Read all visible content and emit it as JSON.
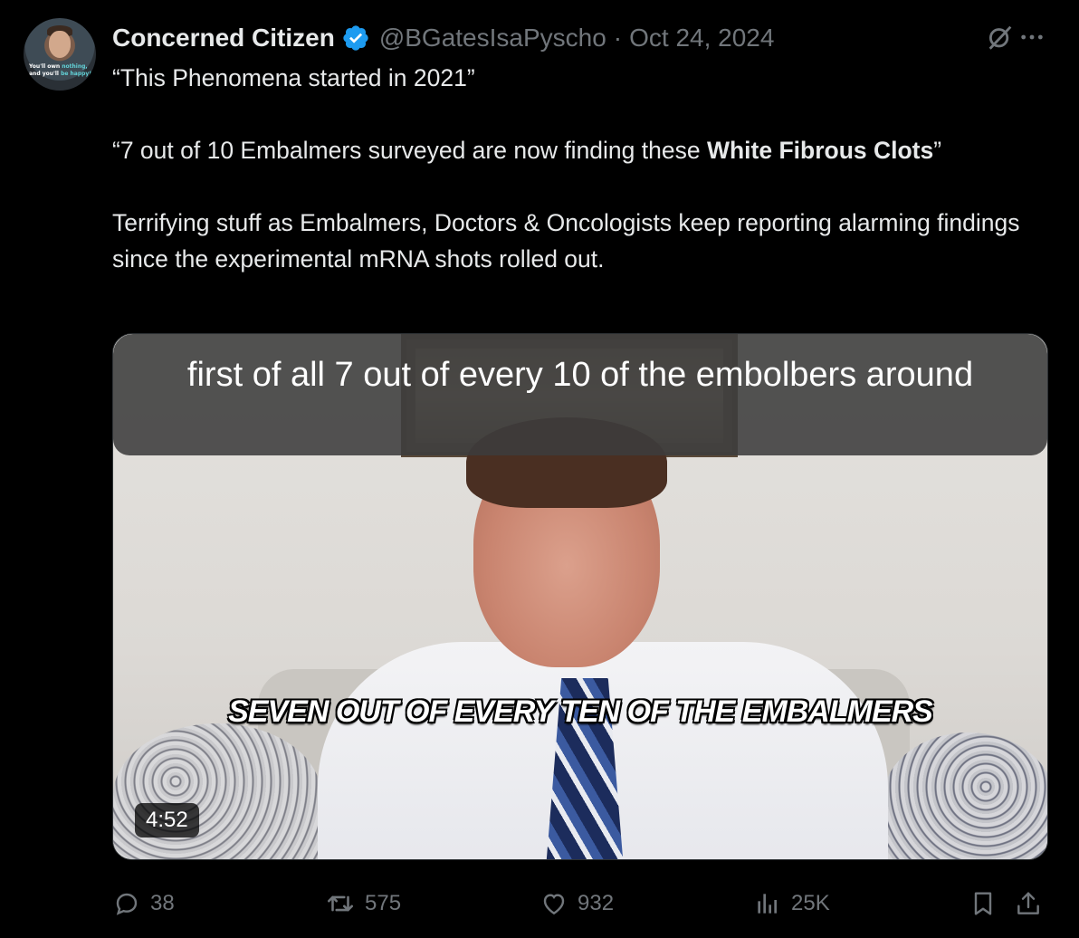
{
  "post": {
    "author_name": "Concerned Citizen",
    "handle": "@BGatesIsaPyscho",
    "separator": "·",
    "date": "Oct 24, 2024",
    "avatar_text_line1_a": "You'll own ",
    "avatar_text_line1_b": "nothing,",
    "avatar_text_line2_a": "and you'll ",
    "avatar_text_line2_b": "be happy!",
    "line1": "“This Phenomena started in 2021”",
    "line2_a": "“7 out of 10 Embalmers surveyed are now finding these ",
    "line2_bold": "White Fibrous Clots",
    "line2_b": "”",
    "line3": "Terrifying stuff as Embalmers, Doctors & Oncologists keep reporting alarming findings since the experimental mRNA shots rolled out."
  },
  "media": {
    "caption_top": "first of all 7 out of every 10 of the embolbers around",
    "caption_bottom": "SEVEN OUT OF EVERY TEN OF THE EMBALMERS",
    "duration": "4:52"
  },
  "actions": {
    "replies": "38",
    "reposts": "575",
    "likes": "932",
    "views": "25K"
  },
  "icons": {
    "verified": "verified-badge-icon",
    "grok": "grok-icon",
    "more": "more-icon",
    "reply": "reply-icon",
    "repost": "repost-icon",
    "like": "heart-icon",
    "views": "views-icon",
    "bookmark": "bookmark-icon",
    "share": "share-icon"
  },
  "colors": {
    "background": "#000000",
    "text": "#e7e9ea",
    "muted": "#71767b",
    "verified": "#1d9bf0"
  }
}
